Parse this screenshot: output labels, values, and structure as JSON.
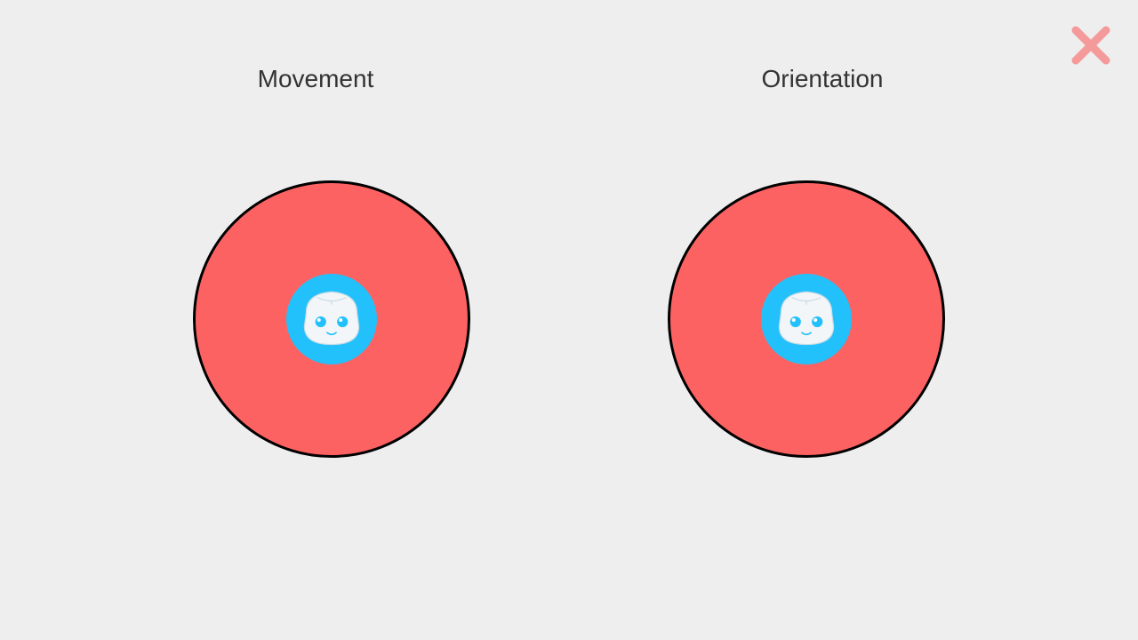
{
  "labels": {
    "movement": "Movement",
    "orientation": "Orientation"
  },
  "icons": {
    "close": "close-icon",
    "knob": "robot-face-icon"
  },
  "colors": {
    "background": "#eeeeee",
    "pad_fill": "#fc6262",
    "pad_border": "#000000",
    "knob_fill": "#22c1fb",
    "close": "#f49a9a",
    "label_text": "#333333"
  }
}
